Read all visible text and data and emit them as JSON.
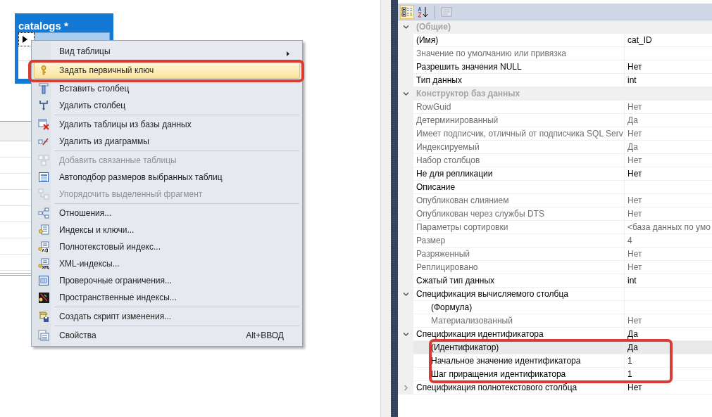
{
  "diagram": {
    "table": {
      "title": "catalogs *"
    }
  },
  "context_menu": {
    "items": [
      {
        "kind": "item",
        "label": "Вид таблицы",
        "submenu": true,
        "selected": false,
        "disabled": false,
        "highlighted": false
      },
      {
        "kind": "item",
        "label": "Задать первичный ключ",
        "submenu": false,
        "selected": true,
        "disabled": false,
        "highlighted": true
      },
      {
        "kind": "item",
        "label": "Вставить столбец",
        "submenu": false,
        "selected": false,
        "disabled": false,
        "highlighted": false
      },
      {
        "kind": "item",
        "label": "Удалить столбец",
        "submenu": false,
        "selected": false,
        "disabled": false,
        "highlighted": false
      },
      {
        "kind": "separator"
      },
      {
        "kind": "item",
        "label": "Удалить таблицы из базы данных",
        "submenu": false,
        "selected": false,
        "disabled": false,
        "highlighted": false
      },
      {
        "kind": "item",
        "label": "Удалить из диаграммы",
        "submenu": false,
        "selected": false,
        "disabled": false,
        "highlighted": false
      },
      {
        "kind": "separator"
      },
      {
        "kind": "item",
        "label": "Добавить связанные таблицы",
        "submenu": false,
        "selected": false,
        "disabled": true,
        "highlighted": false
      },
      {
        "kind": "item",
        "label": "Автоподбор размеров выбранных таблиц",
        "submenu": false,
        "selected": false,
        "disabled": false,
        "highlighted": false
      },
      {
        "kind": "item",
        "label": "Упорядочить выделенный фрагмент",
        "submenu": false,
        "selected": false,
        "disabled": true,
        "highlighted": false
      },
      {
        "kind": "separator"
      },
      {
        "kind": "item",
        "label": "Отношения...",
        "submenu": false,
        "selected": false,
        "disabled": false,
        "highlighted": false
      },
      {
        "kind": "item",
        "label": "Индексы и ключи...",
        "submenu": false,
        "selected": false,
        "disabled": false,
        "highlighted": false
      },
      {
        "kind": "item",
        "label": "Полнотекстовый индекс...",
        "submenu": false,
        "selected": false,
        "disabled": false,
        "highlighted": false
      },
      {
        "kind": "item",
        "label": "XML-индексы...",
        "submenu": false,
        "selected": false,
        "disabled": false,
        "highlighted": false
      },
      {
        "kind": "item",
        "label": "Проверочные ограничения...",
        "submenu": false,
        "selected": false,
        "disabled": false,
        "highlighted": false
      },
      {
        "kind": "item",
        "label": "Пространственные индексы...",
        "submenu": false,
        "selected": false,
        "disabled": false,
        "highlighted": false
      },
      {
        "kind": "separator"
      },
      {
        "kind": "item",
        "label": "Создать скрипт изменения...",
        "submenu": false,
        "selected": false,
        "disabled": false,
        "highlighted": false
      },
      {
        "kind": "separator"
      },
      {
        "kind": "item",
        "label": "Свойства",
        "shortcut": "Alt+ВВОД",
        "submenu": false,
        "selected": false,
        "disabled": false,
        "highlighted": false
      }
    ]
  },
  "properties": {
    "toolbar": [
      {
        "kind": "categorized",
        "selected": true,
        "disabled": false
      },
      {
        "kind": "alphabetical",
        "selected": false,
        "disabled": false
      },
      {
        "kind": "separator"
      },
      {
        "kind": "pages",
        "selected": false,
        "disabled": true
      }
    ],
    "rows": [
      {
        "kind": "category",
        "name": "(Общие)",
        "expanded": true,
        "children": [
          {
            "kind": "property",
            "name": "(Имя)",
            "value": "cat_ID",
            "readonly": false,
            "selected": false,
            "highlighted": false
          },
          {
            "kind": "property",
            "name": "Значение по умолчанию или привязка",
            "readonly": true,
            "selected": false,
            "highlighted": false
          },
          {
            "kind": "property",
            "name": "Разрешить значения NULL",
            "value": "Нет",
            "readonly": false,
            "selected": false,
            "highlighted": false
          },
          {
            "kind": "property",
            "name": "Тип данных",
            "value": "int",
            "readonly": false,
            "selected": false,
            "highlighted": false
          }
        ]
      },
      {
        "kind": "category",
        "name": "Конструктор баз данных",
        "expanded": true,
        "children": [
          {
            "kind": "property",
            "name": "RowGuid",
            "value": "Нет",
            "readonly": true,
            "selected": false,
            "highlighted": false
          },
          {
            "kind": "property",
            "name": "Детерминированный",
            "value": "Да",
            "readonly": true,
            "selected": false,
            "highlighted": false
          },
          {
            "kind": "property",
            "name": "Имеет подписчик, отличный от подписчика SQL Serv",
            "value": "Нет",
            "readonly": true,
            "selected": false,
            "highlighted": false
          },
          {
            "kind": "property",
            "name": "Индексируемый",
            "value": "Да",
            "readonly": true,
            "selected": false,
            "highlighted": false
          },
          {
            "kind": "property",
            "name": "Набор столбцов",
            "value": "Нет",
            "readonly": true,
            "selected": false,
            "highlighted": false
          },
          {
            "kind": "property",
            "name": "Не для репликации",
            "value": "Нет",
            "readonly": false,
            "selected": false,
            "highlighted": false
          },
          {
            "kind": "property",
            "name": "Описание",
            "readonly": false,
            "selected": false,
            "highlighted": false
          },
          {
            "kind": "property",
            "name": "Опубликован слиянием",
            "value": "Нет",
            "readonly": true,
            "selected": false,
            "highlighted": false
          },
          {
            "kind": "property",
            "name": "Опубликован через службы DTS",
            "value": "Нет",
            "readonly": true,
            "selected": false,
            "highlighted": false
          },
          {
            "kind": "property",
            "name": "Параметры сортировки",
            "value": "<база данных по умо",
            "readonly": true,
            "selected": false,
            "highlighted": false
          },
          {
            "kind": "property",
            "name": "Размер",
            "value": "4",
            "readonly": true,
            "selected": false,
            "highlighted": false
          },
          {
            "kind": "property",
            "name": "Разряженный",
            "value": "Нет",
            "readonly": true,
            "selected": false,
            "highlighted": false
          },
          {
            "kind": "property",
            "name": "Реплицировано",
            "value": "Нет",
            "readonly": true,
            "selected": false,
            "highlighted": false
          },
          {
            "kind": "property",
            "name": "Сжатый тип данных",
            "value": "int",
            "readonly": false,
            "selected": false,
            "highlighted": false
          },
          {
            "kind": "property",
            "name": "Спецификация вычисляемого столбца",
            "readonly": false,
            "selected": false,
            "highlighted": false,
            "expanded": true,
            "children": [
              {
                "kind": "property",
                "name": "(Формула)",
                "readonly": false,
                "selected": false,
                "highlighted": false
              },
              {
                "kind": "property",
                "name": "Материализованный",
                "value": "Нет",
                "readonly": true,
                "selected": false,
                "highlighted": false
              }
            ]
          },
          {
            "kind": "property",
            "name": "Спецификация идентификатора",
            "value": "Да",
            "readonly": false,
            "selected": false,
            "highlighted": false,
            "expanded": true,
            "children": [
              {
                "kind": "property",
                "name": "(Идентификатор)",
                "value": "Да",
                "readonly": false,
                "selected": true,
                "highlighted": true
              },
              {
                "kind": "property",
                "name": "Начальное значение идентификатора",
                "value": "1",
                "readonly": false,
                "selected": false,
                "highlighted": true
              },
              {
                "kind": "property",
                "name": "Шаг приращения идентификатора",
                "value": "1",
                "readonly": false,
                "selected": false,
                "highlighted": true
              }
            ]
          },
          {
            "kind": "property",
            "name": "Спецификация полнотекстового столбца",
            "value": "Нет",
            "readonly": false,
            "selected": false,
            "highlighted": false,
            "expanded": false
          }
        ]
      }
    ]
  }
}
